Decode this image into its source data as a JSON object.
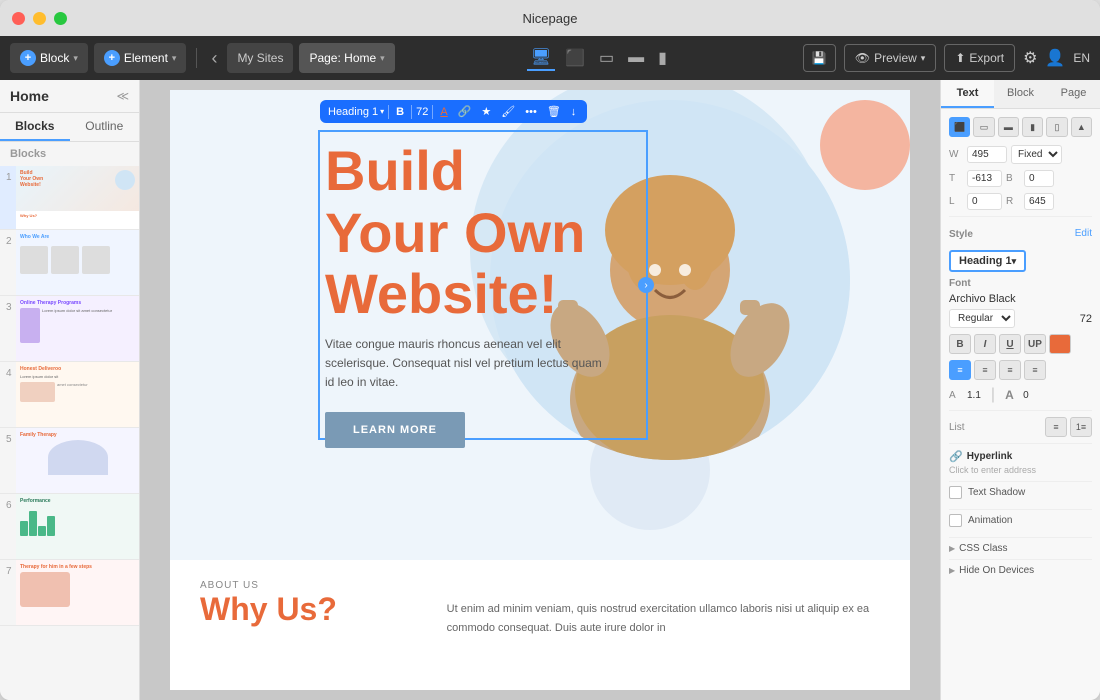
{
  "window": {
    "title": "Nicepage"
  },
  "toolbar": {
    "block_label": "Block",
    "element_label": "Element",
    "my_sites_label": "My Sites",
    "page_label": "Page: Home",
    "preview_label": "Preview",
    "export_label": "Export",
    "lang_label": "EN"
  },
  "sidebar": {
    "title": "Home",
    "tabs": [
      "Blocks",
      "Outline"
    ],
    "blocks_label": "Blocks",
    "pages": [
      {
        "number": "1",
        "type": "hero"
      },
      {
        "number": "2",
        "type": "team"
      },
      {
        "number": "3",
        "type": "therapy"
      },
      {
        "number": "4",
        "type": "clients"
      },
      {
        "number": "5",
        "type": "family"
      },
      {
        "number": "6",
        "type": "performance"
      },
      {
        "number": "7",
        "type": "therapy2"
      }
    ]
  },
  "canvas": {
    "heading_toolbar": {
      "heading_label": "Heading 1",
      "bold_label": "B",
      "size_label": "72",
      "font_color_label": "A",
      "link_label": "🔗",
      "star_label": "★",
      "paint_label": "🖌",
      "more_label": "•••",
      "delete_label": "🗑",
      "down_label": "↓"
    },
    "hero": {
      "heading_line1": "Build",
      "heading_line2": "Your Own",
      "heading_line3": "Website!",
      "body_text": "Vitae congue mauris rhoncus aenean vel elit scelerisque. Consequat nisl vel pretium lectus quam id leo in vitae.",
      "cta_label": "LEARN MORE"
    },
    "about": {
      "label": "ABOUT US",
      "heading": "Why Us?",
      "body_text": "Ut enim ad minim veniam, quis nostrud exercitation ullamco laboris nisi ut aliquip ex ea commodo consequat. Duis aute irure dolor in"
    }
  },
  "right_panel": {
    "tabs": [
      "Text",
      "Block",
      "Page"
    ],
    "active_tab": "Text",
    "alignment": {
      "buttons": [
        "align-left",
        "align-center",
        "align-right",
        "justify-left",
        "justify-center",
        "justify-right"
      ]
    },
    "dimensions": {
      "w_label": "W",
      "w_value": "495",
      "fixed_label": "Fixed",
      "t_label": "T",
      "t_value": "-613",
      "b_label": "B",
      "b_value": "0",
      "l_label": "L",
      "l_value": "0",
      "r_label": "R",
      "r_value": "645"
    },
    "style": {
      "label": "Style",
      "edit_label": "Edit",
      "heading_style": "Heading 1"
    },
    "font": {
      "label": "Font",
      "name": "Archivo Black",
      "style": "Regular",
      "size": "72"
    },
    "format": {
      "bold": "B",
      "italic": "I",
      "underline": "U",
      "uppercase": "UP"
    },
    "text_align": {
      "options": [
        "left",
        "center",
        "right",
        "justify"
      ]
    },
    "spacing": {
      "a_label": "A",
      "a_value": "1.1",
      "a_cap_label": "A",
      "a_cap_value": "0"
    },
    "list": {
      "label": "List",
      "unordered": "ul",
      "ordered": "ol"
    },
    "hyperlink": {
      "label": "Hyperlink",
      "description": "Click to enter address"
    },
    "text_shadow": {
      "label": "Text Shadow"
    },
    "animation": {
      "label": "Animation"
    },
    "css_class": {
      "label": "CSS Class"
    },
    "hide_on_devices": {
      "label": "Hide On Devices"
    }
  }
}
